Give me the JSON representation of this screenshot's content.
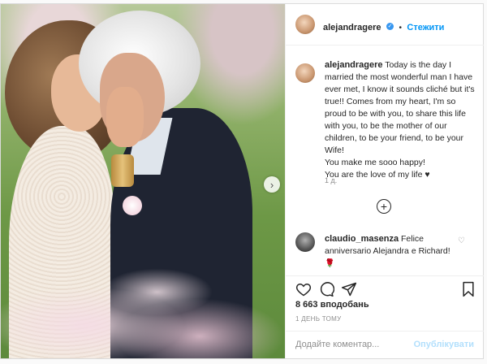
{
  "post": {
    "author": {
      "username": "alejandragere",
      "follow_label": "Стежити"
    },
    "caption": {
      "username": "alejandragere",
      "lines": [
        "Today is the day I married the most wonderful man I have ever met, I know it sounds cliché but it's true!! Comes from my heart, I'm so proud to be with you, to share this life with you, to be the mother of our children, to be your friend, to be your Wife!",
        "You make me sooo happy!",
        "You are the love of my life ♥"
      ],
      "time": "1 д."
    },
    "comment": {
      "username": "claudio_masenza",
      "text": "Felice anniversario Alejandra e Richard!",
      "emoji": "🌹"
    },
    "likes_label": "8 663 вподобань",
    "date_label": "1 ДЕНЬ ТОМУ",
    "add_comment": {
      "placeholder": "Додайте коментар...",
      "publish_label": "Опублікувати"
    },
    "icons": {
      "like": "heart-icon",
      "comment": "comment-icon",
      "share": "share-icon",
      "save": "bookmark-icon",
      "more_comments": "plus-circle-icon",
      "next": "chevron-right-icon"
    }
  }
}
